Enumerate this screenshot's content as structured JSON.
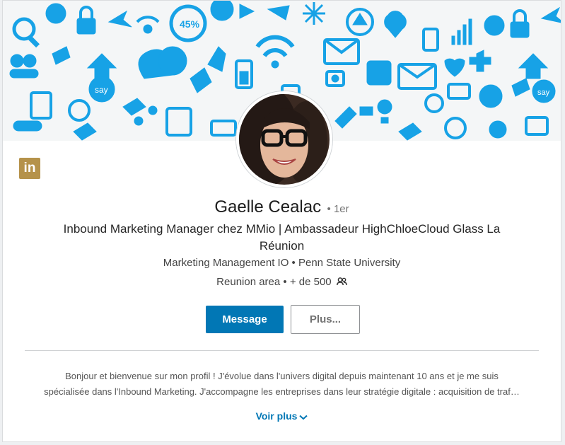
{
  "profile": {
    "name": "Gaelle Cealac",
    "degree": "• 1er",
    "headline": "Inbound Marketing Manager chez MMio | Ambassadeur HighChloeCloud Glass La Réunion",
    "company_school": "Marketing Management IO • Penn State University",
    "location_connections": "Reunion area • + de 500",
    "connections_icon": "people-icon"
  },
  "actions": {
    "message_label": "Message",
    "more_label": "Plus..."
  },
  "summary": {
    "line1": "Bonjour et bienvenue sur mon profil ! J'évolue dans l'univers digital depuis maintenant 10 ans et je me suis",
    "line2": "spécialisée dans l'Inbound Marketing. J'accompagne les entreprises dans leur stratégie digitale : acquisition de traf…",
    "see_more": "Voir plus"
  },
  "logo": {
    "text": "in"
  },
  "banner_badge": "45%",
  "colors": {
    "accent": "#0177b5",
    "banner_icon": "#17a2e6",
    "logo": "#b5924a"
  }
}
